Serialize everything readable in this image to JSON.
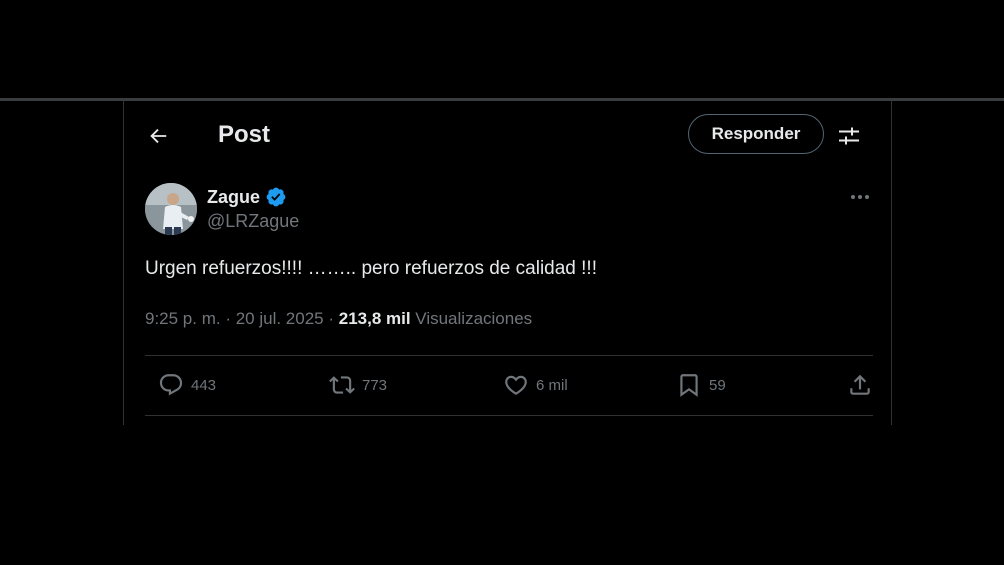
{
  "header": {
    "title": "Post",
    "reply_label": "Responder",
    "back_icon": "arrow-left-icon",
    "filter_icon": "sliders-icon"
  },
  "post": {
    "author": {
      "name": "Zague",
      "handle": "@LRZague",
      "verified": true
    },
    "text": "Urgen refuerzos!!!! …….. pero refuerzos de calidad !!!",
    "time": "9:25 p. m.",
    "separator1": " · ",
    "date": "20 jul. 2025",
    "separator2": " · ",
    "views_count": "213,8 mil",
    "views_label": "Visualizaciones"
  },
  "stats": {
    "replies": "443",
    "reposts": "773",
    "likes": "6 mil",
    "bookmarks": "59"
  },
  "colors": {
    "background": "#000000",
    "text": "#e7e9ea",
    "muted": "#71767b",
    "border": "#2f3336",
    "verified": "#1d9bf0"
  }
}
